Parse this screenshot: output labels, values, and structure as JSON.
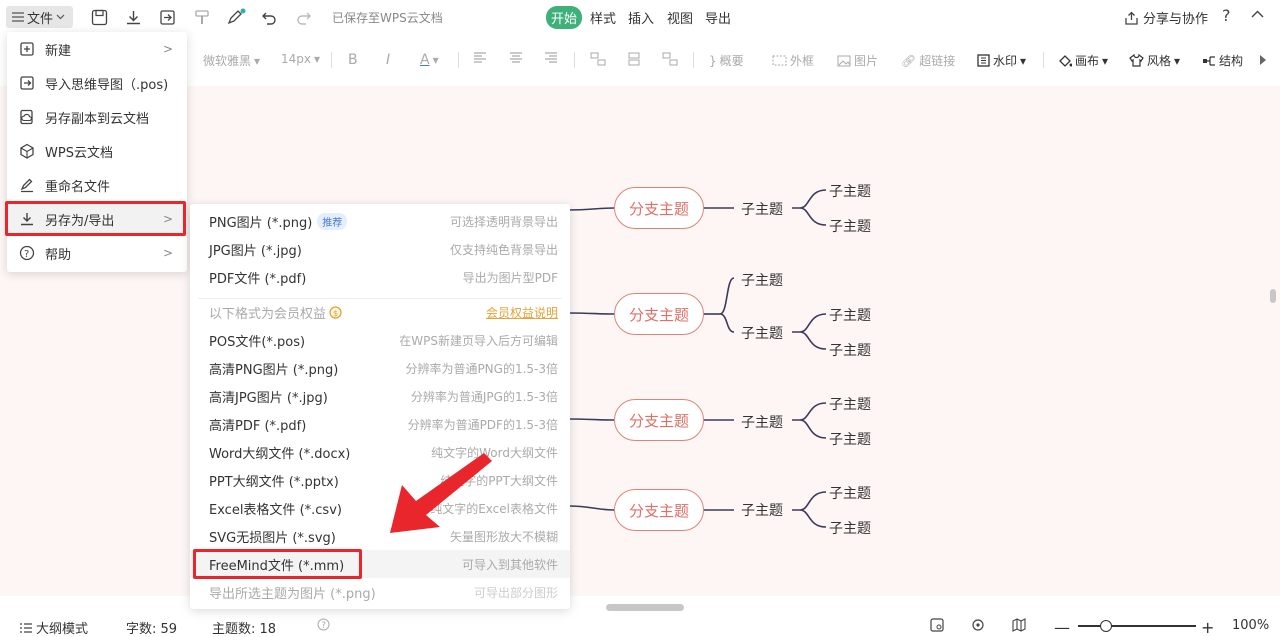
{
  "topbar": {
    "file_label": "文件",
    "saved_status": "已保存至WPS云文档",
    "tabs": [
      "开始",
      "样式",
      "插入",
      "视图",
      "导出"
    ],
    "share_label": "分享与协作",
    "help": "?"
  },
  "toolbar": {
    "font": "微软雅黑",
    "size": "14px",
    "bold": "B",
    "italic": "I",
    "font_color": "A",
    "summary": "概要",
    "frame": "外框",
    "image": "图片",
    "hyperlink": "超链接",
    "watermark": "水印",
    "canvas": "画布",
    "style": "风格",
    "structure": "结构"
  },
  "mindmap": {
    "branch_label": "分支主题",
    "sub_label": "子主题"
  },
  "file_menu": {
    "items": [
      {
        "label": "新建",
        "icon": "new-icon",
        "has_sub": true
      },
      {
        "label": "导入思维导图（.pos)",
        "icon": "import-icon",
        "has_sub": false
      },
      {
        "label": "另存副本到云文档",
        "icon": "copy-cloud-icon",
        "has_sub": false
      },
      {
        "label": "WPS云文档",
        "icon": "cloud-doc-icon",
        "has_sub": false
      },
      {
        "label": "重命名文件",
        "icon": "rename-icon",
        "has_sub": false
      },
      {
        "label": "另存为/导出",
        "icon": "download-icon",
        "has_sub": true
      },
      {
        "label": "帮助",
        "icon": "help-icon",
        "has_sub": true
      }
    ]
  },
  "export_menu": {
    "recommended_badge": "推荐",
    "member_header": "以下格式为会员权益",
    "member_link": "会员权益说明",
    "items": [
      {
        "label": "PNG图片 (*.png)",
        "desc": "可选择透明背景导出"
      },
      {
        "label": "JPG图片 (*.jpg)",
        "desc": "仅支持纯色背景导出"
      },
      {
        "label": "PDF文件 (*.pdf)",
        "desc": "导出为图片型PDF"
      },
      {
        "label": "POS文件(*.pos)",
        "desc": "在WPS新建页导入后方可编辑"
      },
      {
        "label": "高清PNG图片 (*.png)",
        "desc": "分辨率为普通PNG的1.5-3倍"
      },
      {
        "label": "高清JPG图片 (*.jpg)",
        "desc": "分辨率为普通JPG的1.5-3倍"
      },
      {
        "label": "高清PDF (*.pdf)",
        "desc": "分辨率为普通PDF的1.5-3倍"
      },
      {
        "label": "Word大纲文件 (*.docx)",
        "desc": "纯文字的Word大纲文件"
      },
      {
        "label": "PPT大纲文件 (*.pptx)",
        "desc": "纯文字的PPT大纲文件"
      },
      {
        "label": "Excel表格文件 (*.csv)",
        "desc": "纯文字的Excel表格文件"
      },
      {
        "label": "SVG无损图片 (*.svg)",
        "desc": "矢量图形放大不模糊"
      },
      {
        "label": "FreeMind文件 (*.mm)",
        "desc": "可导入到其他软件"
      },
      {
        "label": "导出所选主题为图片 (*.png)",
        "desc": "可导出部分图形"
      }
    ]
  },
  "statusbar": {
    "outline_mode": "大纲模式",
    "word_count": "字数: 59",
    "topic_count": "主题数: 18",
    "zoom": "100%"
  },
  "colors": {
    "accent_green": "#3fb079",
    "branch_border": "#e08377",
    "highlight_red": "#e8262b"
  }
}
